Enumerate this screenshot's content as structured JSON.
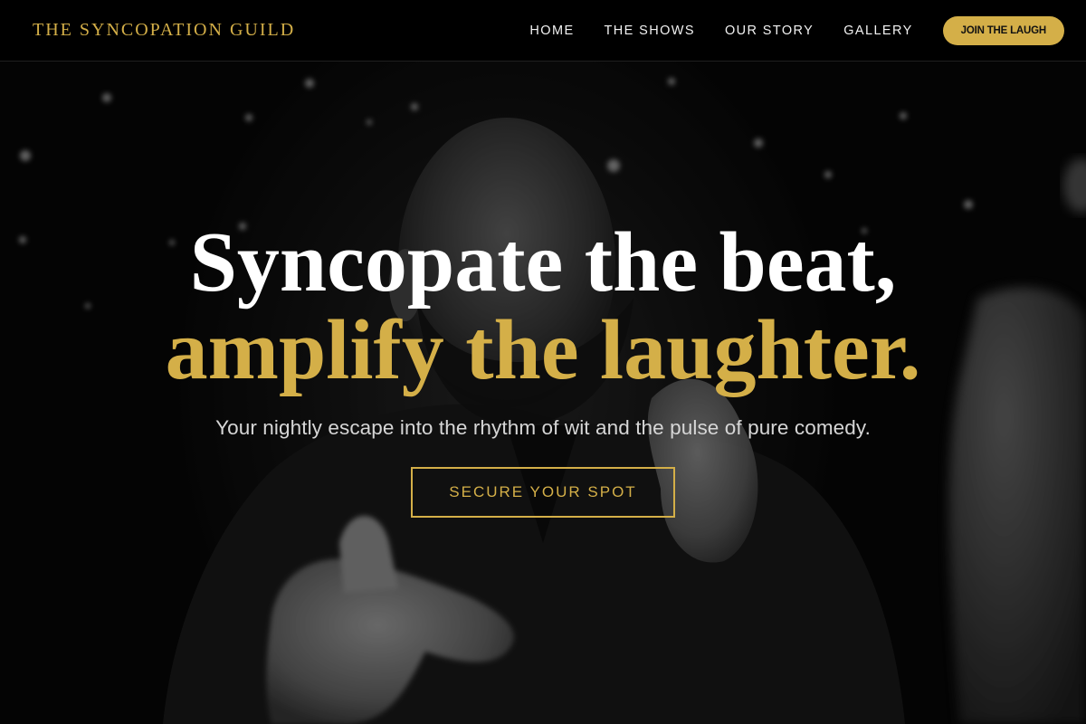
{
  "header": {
    "brand": "THE SYNCOPATION GUILD",
    "nav": [
      {
        "label": "HOME"
      },
      {
        "label": "THE SHOWS"
      },
      {
        "label": "OUR STORY"
      },
      {
        "label": "GALLERY"
      }
    ],
    "cta_label": "JOIN THE LAUGH"
  },
  "hero": {
    "headline_line1": "Syncopate the beat,",
    "headline_line2": "amplify the laughter.",
    "subtitle": "Your nightly escape into the rhythm of wit and the pulse of pure comedy.",
    "cta_label": "SECURE YOUR SPOT",
    "background_image": "black-and-white photo of a laughing bald bearded comedian pointing at the camera"
  },
  "colors": {
    "accent": "#d4af48",
    "header_bg": "#000000",
    "headline_primary": "#ffffff",
    "subtitle": "#d6d6d6"
  }
}
